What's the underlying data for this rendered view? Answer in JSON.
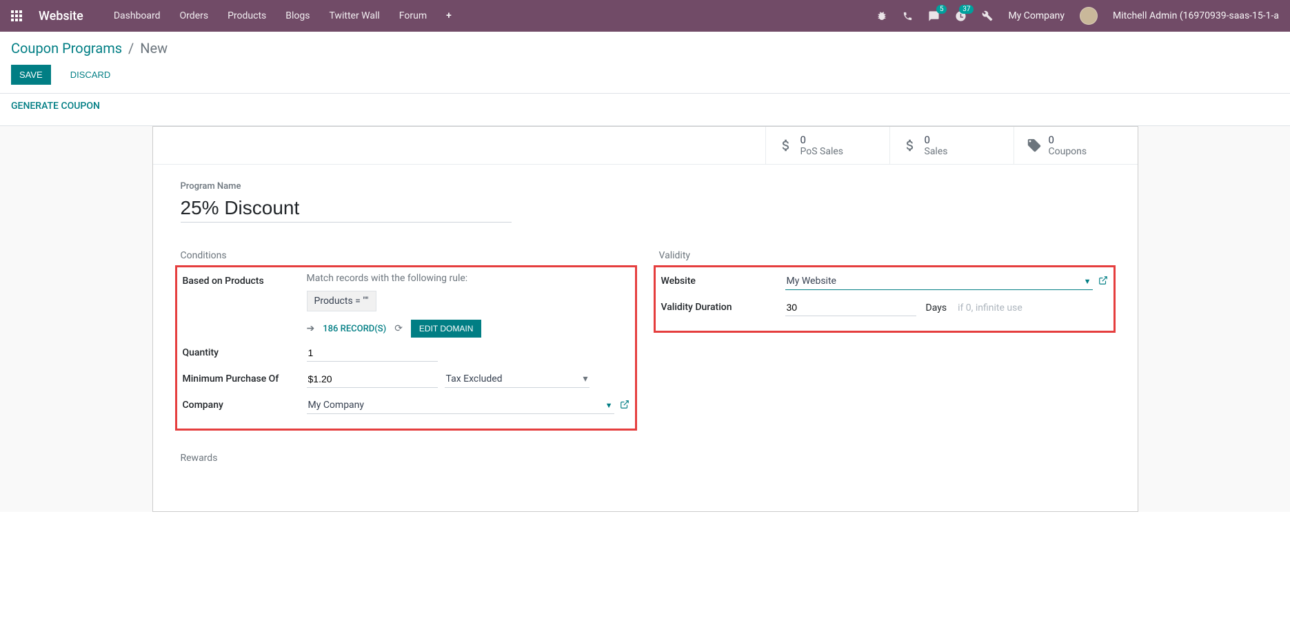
{
  "nav": {
    "brand": "Website",
    "menu": [
      "Dashboard",
      "Orders",
      "Products",
      "Blogs",
      "Twitter Wall",
      "Forum"
    ],
    "messages_badge": "5",
    "activities_badge": "37",
    "company": "My Company",
    "user": "Mitchell Admin (16970939-saas-15-1-a"
  },
  "breadcrumb": {
    "parent": "Coupon Programs",
    "current": "New"
  },
  "buttons": {
    "save": "SAVE",
    "discard": "DISCARD",
    "generate": "GENERATE COUPON",
    "edit_domain": "EDIT DOMAIN"
  },
  "stats": {
    "pos_sales": {
      "value": "0",
      "label": "PoS Sales"
    },
    "sales": {
      "value": "0",
      "label": "Sales"
    },
    "coupons": {
      "value": "0",
      "label": "Coupons"
    }
  },
  "form": {
    "program_name_label": "Program Name",
    "program_name_value": "25% Discount",
    "conditions": {
      "title": "Conditions",
      "based_on_products_label": "Based on Products",
      "match_text": "Match records with the following rule:",
      "domain_chip": "Products  =  \"\"",
      "records": "186 RECORD(S)",
      "quantity_label": "Quantity",
      "quantity_value": "1",
      "min_purchase_label": "Minimum Purchase Of",
      "min_purchase_value": "$1.20",
      "tax_option": "Tax Excluded",
      "company_label": "Company",
      "company_value": "My Company"
    },
    "validity": {
      "title": "Validity",
      "website_label": "Website",
      "website_value": "My Website",
      "duration_label": "Validity Duration",
      "duration_value": "30",
      "days_label": "Days",
      "hint": "if 0, infinite use"
    },
    "rewards_title": "Rewards"
  }
}
